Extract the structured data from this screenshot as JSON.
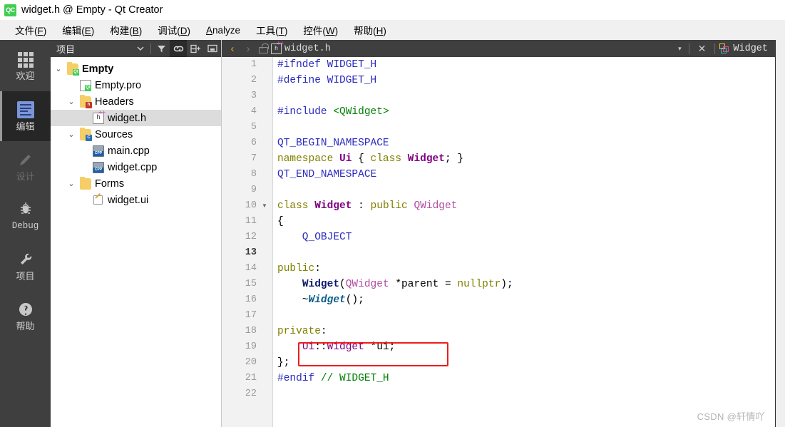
{
  "window": {
    "logo_text": "QC",
    "title": "widget.h @ Empty - Qt Creator"
  },
  "menubar": [
    {
      "label": "文件(F)",
      "accel": "F"
    },
    {
      "label": "编辑(E)",
      "accel": "E"
    },
    {
      "label": "构建(B)",
      "accel": "B"
    },
    {
      "label": "调试(D)",
      "accel": "D"
    },
    {
      "label": "Analyze",
      "accel": "A"
    },
    {
      "label": "工具(T)",
      "accel": "T"
    },
    {
      "label": "控件(W)",
      "accel": "W"
    },
    {
      "label": "帮助(H)",
      "accel": "H"
    }
  ],
  "modebar": [
    {
      "label": "欢迎",
      "icon": "grid-icon",
      "state": "normal"
    },
    {
      "label": "编辑",
      "icon": "edit-document-icon",
      "state": "active"
    },
    {
      "label": "设计",
      "icon": "pencil-icon",
      "state": "disabled"
    },
    {
      "label": "Debug",
      "icon": "bug-icon",
      "state": "normal"
    },
    {
      "label": "项目",
      "icon": "wrench-icon",
      "state": "normal"
    },
    {
      "label": "帮助",
      "icon": "question-circle-icon",
      "state": "normal"
    }
  ],
  "project_panel": {
    "title": "项目",
    "buttons": [
      {
        "name": "dropdown-arrow-icon",
        "glyph": "▾",
        "active": false
      },
      {
        "name": "filter-icon",
        "glyph": "⏷",
        "active": false
      },
      {
        "name": "link-with-editor-icon",
        "glyph": "⛓",
        "active": true
      },
      {
        "name": "split-icon",
        "glyph": "⊟",
        "active": false
      },
      {
        "name": "collapse-icon",
        "glyph": "▣",
        "active": false
      }
    ],
    "tree": [
      {
        "label": "Empty",
        "level": 0,
        "arrow": "⌄",
        "icon": "folder-qt-icon",
        "bold": true,
        "selected": false
      },
      {
        "label": "Empty.pro",
        "level": 1,
        "arrow": "",
        "icon": "file-qt-icon",
        "bold": false,
        "selected": false
      },
      {
        "label": "Headers",
        "level": 1,
        "arrow": "⌄",
        "icon": "folder-h-icon",
        "bold": false,
        "selected": false
      },
      {
        "label": "widget.h",
        "level": 2,
        "arrow": "",
        "icon": "file-header-icon",
        "bold": false,
        "selected": true
      },
      {
        "label": "Sources",
        "level": 1,
        "arrow": "⌄",
        "icon": "folder-cpp-icon",
        "bold": false,
        "selected": false
      },
      {
        "label": "main.cpp",
        "level": 2,
        "arrow": "",
        "icon": "file-cpp-icon",
        "bold": false,
        "selected": false
      },
      {
        "label": "widget.cpp",
        "level": 2,
        "arrow": "",
        "icon": "file-cpp-icon",
        "bold": false,
        "selected": false
      },
      {
        "label": "Forms",
        "level": 1,
        "arrow": "⌄",
        "icon": "folder-ui-icon",
        "bold": false,
        "selected": false
      },
      {
        "label": "widget.ui",
        "level": 2,
        "arrow": "",
        "icon": "file-ui-icon",
        "bold": false,
        "selected": false
      }
    ]
  },
  "editor_bar": {
    "back_glyph": "‹",
    "forward_glyph": "›",
    "filename": "widget.h",
    "dropdown_glyph": "▾",
    "close_glyph": "✕",
    "symbol": "Widget"
  },
  "editor": {
    "current_line": 13,
    "fold_line": 10,
    "lines": [
      {
        "n": 1,
        "tokens": [
          {
            "t": "#ifndef ",
            "c": "k-pre"
          },
          {
            "t": "WIDGET_H",
            "c": "k-pre"
          }
        ]
      },
      {
        "n": 2,
        "tokens": [
          {
            "t": "#define ",
            "c": "k-pre"
          },
          {
            "t": "WIDGET_H",
            "c": "k-pre"
          }
        ]
      },
      {
        "n": 3,
        "tokens": []
      },
      {
        "n": 4,
        "tokens": [
          {
            "t": "#include ",
            "c": "k-pre"
          },
          {
            "t": "<QWidget>",
            "c": "k-inc"
          }
        ]
      },
      {
        "n": 5,
        "tokens": []
      },
      {
        "n": 6,
        "tokens": [
          {
            "t": "QT_BEGIN_NAMESPACE",
            "c": "k-macro"
          }
        ]
      },
      {
        "n": 7,
        "tokens": [
          {
            "t": "namespace ",
            "c": "k-kw"
          },
          {
            "t": "Ui",
            "c": "k-tb"
          },
          {
            "t": " { ",
            "c": "k-op"
          },
          {
            "t": "class ",
            "c": "k-kw"
          },
          {
            "t": "Widget",
            "c": "k-tb"
          },
          {
            "t": "; }",
            "c": "k-op"
          }
        ]
      },
      {
        "n": 8,
        "tokens": [
          {
            "t": "QT_END_NAMESPACE",
            "c": "k-macro"
          }
        ]
      },
      {
        "n": 9,
        "tokens": []
      },
      {
        "n": 10,
        "tokens": [
          {
            "t": "class ",
            "c": "k-kw"
          },
          {
            "t": "Widget",
            "c": "k-tb"
          },
          {
            "t": " : ",
            "c": "k-op"
          },
          {
            "t": "public ",
            "c": "k-kw"
          },
          {
            "t": "QWidget",
            "c": "k-cls"
          }
        ]
      },
      {
        "n": 11,
        "tokens": [
          {
            "t": "{",
            "c": "k-op"
          }
        ]
      },
      {
        "n": 12,
        "tokens": [
          {
            "t": "    Q_OBJECT",
            "c": "k-macro"
          }
        ]
      },
      {
        "n": 13,
        "tokens": []
      },
      {
        "n": 14,
        "tokens": [
          {
            "t": "public",
            "c": "k-kw"
          },
          {
            "t": ":",
            "c": "k-op"
          }
        ]
      },
      {
        "n": 15,
        "tokens": [
          {
            "t": "    ",
            "c": "k-op"
          },
          {
            "t": "Widget",
            "c": "k-fn"
          },
          {
            "t": "(",
            "c": "k-op"
          },
          {
            "t": "QWidget",
            "c": "k-cls"
          },
          {
            "t": " *parent = ",
            "c": "k-op"
          },
          {
            "t": "nullptr",
            "c": "k-num"
          },
          {
            "t": ");",
            "c": "k-op"
          }
        ]
      },
      {
        "n": 16,
        "tokens": [
          {
            "t": "    ~",
            "c": "k-op"
          },
          {
            "t": "Widget",
            "c": "k-ti"
          },
          {
            "t": "();",
            "c": "k-op"
          }
        ]
      },
      {
        "n": 17,
        "tokens": []
      },
      {
        "n": 18,
        "tokens": [
          {
            "t": "private",
            "c": "k-kw"
          },
          {
            "t": ":",
            "c": "k-op"
          }
        ]
      },
      {
        "n": 19,
        "tokens": [
          {
            "t": "    ",
            "c": "k-op"
          },
          {
            "t": "Ui",
            "c": "k-type"
          },
          {
            "t": "::",
            "c": "k-op"
          },
          {
            "t": "Widget",
            "c": "k-type"
          },
          {
            "t": " *ui;",
            "c": "k-op"
          }
        ]
      },
      {
        "n": 20,
        "tokens": [
          {
            "t": "};",
            "c": "k-op"
          }
        ]
      },
      {
        "n": 21,
        "tokens": [
          {
            "t": "#endif ",
            "c": "k-pre"
          },
          {
            "t": "// WIDGET_H",
            "c": "k-inc"
          }
        ]
      },
      {
        "n": 22,
        "tokens": []
      }
    ],
    "annotation": {
      "name": "red-highlight-box",
      "target_line": 19,
      "color": "#ee1c1c"
    }
  },
  "watermark": {
    "text": "CSDN @轩情吖"
  }
}
